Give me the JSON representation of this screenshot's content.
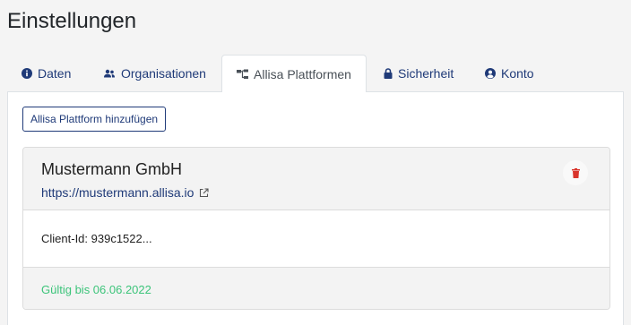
{
  "page": {
    "title": "Einstellungen"
  },
  "tabs": [
    {
      "label": "Daten",
      "icon": "info-icon"
    },
    {
      "label": "Organisationen",
      "icon": "users-icon"
    },
    {
      "label": "Allisa Plattformen",
      "icon": "sitemap-icon",
      "active": true
    },
    {
      "label": "Sicherheit",
      "icon": "lock-icon"
    },
    {
      "label": "Konto",
      "icon": "user-circle-icon"
    }
  ],
  "toolbar": {
    "add_label": "Allisa Plattform hinzufügen"
  },
  "platform": {
    "name": "Mustermann GmbH",
    "url": "https://mustermann.allisa.io",
    "client_id": "Client-Id: 939c1522...",
    "validity": "Gültig bis 06.06.2022"
  },
  "colors": {
    "accent": "#1f3a78",
    "delete": "#d9342b",
    "valid": "#3cc47a"
  }
}
